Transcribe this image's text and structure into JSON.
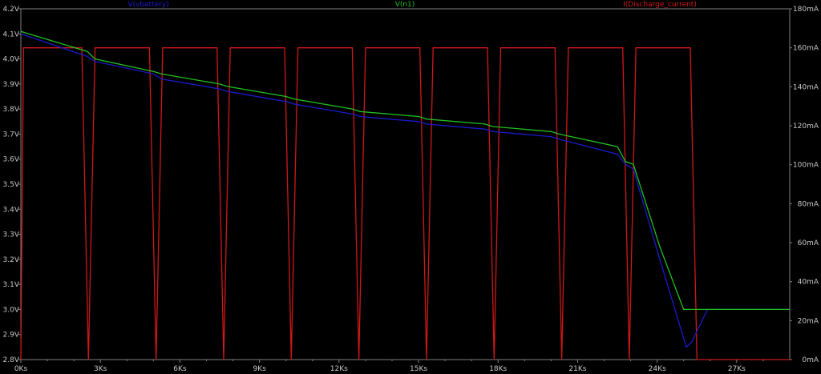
{
  "chart_data": {
    "type": "line",
    "legend": [
      {
        "label": "V(vbattery)",
        "color": "#1a1acc"
      },
      {
        "label": "V(n1)",
        "color": "#20c020"
      },
      {
        "label": "I(Discharge_current)",
        "color": "#d01818"
      }
    ],
    "x_ticks": [
      "0Ks",
      "3Ks",
      "6Ks",
      "9Ks",
      "12Ks",
      "15Ks",
      "18Ks",
      "21Ks",
      "24Ks",
      "27Ks"
    ],
    "y_left_ticks": [
      "4.2V",
      "4.1V",
      "4.0V",
      "3.9V",
      "3.8V",
      "3.7V",
      "3.6V",
      "3.5V",
      "3.4V",
      "3.3V",
      "3.2V",
      "3.1V",
      "3.0V",
      "2.9V",
      "2.8V"
    ],
    "y_right_ticks": [
      "180mA",
      "160mA",
      "140mA",
      "120mA",
      "100mA",
      "80mA",
      "60mA",
      "40mA",
      "20mA",
      "0mA"
    ],
    "xlim": [
      0,
      29000
    ],
    "ylim_left": [
      2.8,
      4.2
    ],
    "ylim_right": [
      0,
      180
    ],
    "grid": false,
    "series": [
      {
        "axis": "left",
        "color": "#1a1acc",
        "x": [
          0,
          2500,
          2800,
          5000,
          5300,
          7500,
          7800,
          10000,
          10300,
          12500,
          12800,
          15000,
          15300,
          17500,
          17800,
          20000,
          20300,
          22500,
          22800,
          23100,
          24100,
          25100,
          25300,
          25900,
          29000
        ],
        "y": [
          4.1,
          4.01,
          3.99,
          3.94,
          3.92,
          3.88,
          3.87,
          3.83,
          3.82,
          3.78,
          3.77,
          3.75,
          3.74,
          3.72,
          3.71,
          3.69,
          3.68,
          3.62,
          3.58,
          3.56,
          3.2,
          2.85,
          2.87,
          3.0,
          3.0
        ]
      },
      {
        "axis": "left",
        "color": "#20c020",
        "x": [
          0,
          2500,
          2800,
          5000,
          5300,
          7500,
          7800,
          10000,
          10300,
          12500,
          12800,
          15000,
          15300,
          17500,
          17800,
          20000,
          20300,
          22500,
          22800,
          23100,
          24100,
          25000,
          29000
        ],
        "y": [
          4.11,
          4.03,
          4.0,
          3.95,
          3.94,
          3.9,
          3.89,
          3.85,
          3.84,
          3.8,
          3.79,
          3.77,
          3.76,
          3.74,
          3.73,
          3.71,
          3.7,
          3.65,
          3.59,
          3.58,
          3.25,
          3.0,
          3.0
        ]
      },
      {
        "axis": "right",
        "color": "#d01818",
        "x": [
          0,
          100,
          2300,
          2550,
          2800,
          4850,
          5100,
          5350,
          7400,
          7650,
          7900,
          9950,
          10200,
          10450,
          12500,
          12750,
          13000,
          15050,
          15300,
          15550,
          17600,
          17850,
          18100,
          20150,
          20400,
          20650,
          22700,
          22950,
          23200,
          25250,
          25500,
          29000
        ],
        "y": [
          0,
          160,
          160,
          0,
          160,
          160,
          0,
          160,
          160,
          0,
          160,
          160,
          0,
          160,
          160,
          0,
          160,
          160,
          0,
          160,
          160,
          0,
          160,
          160,
          0,
          160,
          160,
          0,
          160,
          160,
          0,
          0
        ]
      }
    ]
  }
}
